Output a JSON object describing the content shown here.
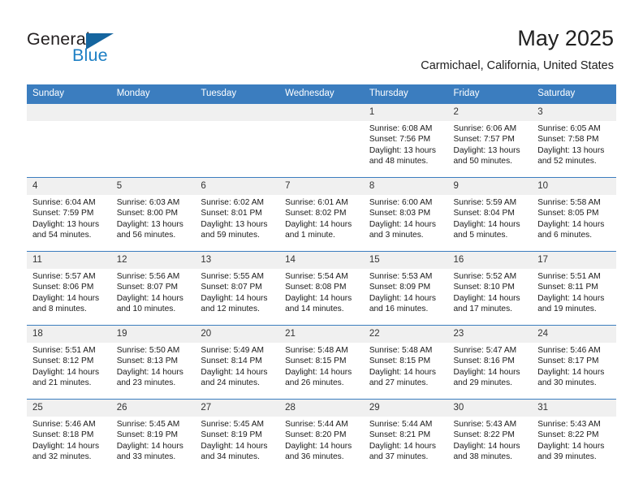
{
  "brand": {
    "name_part1": "General",
    "name_part2": "Blue",
    "flag_icon": "triangle-flag-icon",
    "accent_color": "#1d7fc4",
    "header_color": "#3b7dbf"
  },
  "header": {
    "month_title": "May 2025",
    "location": "Carmichael, California, United States"
  },
  "weekday_headers": [
    "Sunday",
    "Monday",
    "Tuesday",
    "Wednesday",
    "Thursday",
    "Friday",
    "Saturday"
  ],
  "weeks": [
    [
      {
        "day": "",
        "sunrise": "",
        "sunset": "",
        "daylight": "",
        "blank": true
      },
      {
        "day": "",
        "sunrise": "",
        "sunset": "",
        "daylight": "",
        "blank": true
      },
      {
        "day": "",
        "sunrise": "",
        "sunset": "",
        "daylight": "",
        "blank": true
      },
      {
        "day": "",
        "sunrise": "",
        "sunset": "",
        "daylight": "",
        "blank": true
      },
      {
        "day": "1",
        "sunrise": "Sunrise: 6:08 AM",
        "sunset": "Sunset: 7:56 PM",
        "daylight": "Daylight: 13 hours and 48 minutes."
      },
      {
        "day": "2",
        "sunrise": "Sunrise: 6:06 AM",
        "sunset": "Sunset: 7:57 PM",
        "daylight": "Daylight: 13 hours and 50 minutes."
      },
      {
        "day": "3",
        "sunrise": "Sunrise: 6:05 AM",
        "sunset": "Sunset: 7:58 PM",
        "daylight": "Daylight: 13 hours and 52 minutes."
      }
    ],
    [
      {
        "day": "4",
        "sunrise": "Sunrise: 6:04 AM",
        "sunset": "Sunset: 7:59 PM",
        "daylight": "Daylight: 13 hours and 54 minutes."
      },
      {
        "day": "5",
        "sunrise": "Sunrise: 6:03 AM",
        "sunset": "Sunset: 8:00 PM",
        "daylight": "Daylight: 13 hours and 56 minutes."
      },
      {
        "day": "6",
        "sunrise": "Sunrise: 6:02 AM",
        "sunset": "Sunset: 8:01 PM",
        "daylight": "Daylight: 13 hours and 59 minutes."
      },
      {
        "day": "7",
        "sunrise": "Sunrise: 6:01 AM",
        "sunset": "Sunset: 8:02 PM",
        "daylight": "Daylight: 14 hours and 1 minute."
      },
      {
        "day": "8",
        "sunrise": "Sunrise: 6:00 AM",
        "sunset": "Sunset: 8:03 PM",
        "daylight": "Daylight: 14 hours and 3 minutes."
      },
      {
        "day": "9",
        "sunrise": "Sunrise: 5:59 AM",
        "sunset": "Sunset: 8:04 PM",
        "daylight": "Daylight: 14 hours and 5 minutes."
      },
      {
        "day": "10",
        "sunrise": "Sunrise: 5:58 AM",
        "sunset": "Sunset: 8:05 PM",
        "daylight": "Daylight: 14 hours and 6 minutes."
      }
    ],
    [
      {
        "day": "11",
        "sunrise": "Sunrise: 5:57 AM",
        "sunset": "Sunset: 8:06 PM",
        "daylight": "Daylight: 14 hours and 8 minutes."
      },
      {
        "day": "12",
        "sunrise": "Sunrise: 5:56 AM",
        "sunset": "Sunset: 8:07 PM",
        "daylight": "Daylight: 14 hours and 10 minutes."
      },
      {
        "day": "13",
        "sunrise": "Sunrise: 5:55 AM",
        "sunset": "Sunset: 8:07 PM",
        "daylight": "Daylight: 14 hours and 12 minutes."
      },
      {
        "day": "14",
        "sunrise": "Sunrise: 5:54 AM",
        "sunset": "Sunset: 8:08 PM",
        "daylight": "Daylight: 14 hours and 14 minutes."
      },
      {
        "day": "15",
        "sunrise": "Sunrise: 5:53 AM",
        "sunset": "Sunset: 8:09 PM",
        "daylight": "Daylight: 14 hours and 16 minutes."
      },
      {
        "day": "16",
        "sunrise": "Sunrise: 5:52 AM",
        "sunset": "Sunset: 8:10 PM",
        "daylight": "Daylight: 14 hours and 17 minutes."
      },
      {
        "day": "17",
        "sunrise": "Sunrise: 5:51 AM",
        "sunset": "Sunset: 8:11 PM",
        "daylight": "Daylight: 14 hours and 19 minutes."
      }
    ],
    [
      {
        "day": "18",
        "sunrise": "Sunrise: 5:51 AM",
        "sunset": "Sunset: 8:12 PM",
        "daylight": "Daylight: 14 hours and 21 minutes."
      },
      {
        "day": "19",
        "sunrise": "Sunrise: 5:50 AM",
        "sunset": "Sunset: 8:13 PM",
        "daylight": "Daylight: 14 hours and 23 minutes."
      },
      {
        "day": "20",
        "sunrise": "Sunrise: 5:49 AM",
        "sunset": "Sunset: 8:14 PM",
        "daylight": "Daylight: 14 hours and 24 minutes."
      },
      {
        "day": "21",
        "sunrise": "Sunrise: 5:48 AM",
        "sunset": "Sunset: 8:15 PM",
        "daylight": "Daylight: 14 hours and 26 minutes."
      },
      {
        "day": "22",
        "sunrise": "Sunrise: 5:48 AM",
        "sunset": "Sunset: 8:15 PM",
        "daylight": "Daylight: 14 hours and 27 minutes."
      },
      {
        "day": "23",
        "sunrise": "Sunrise: 5:47 AM",
        "sunset": "Sunset: 8:16 PM",
        "daylight": "Daylight: 14 hours and 29 minutes."
      },
      {
        "day": "24",
        "sunrise": "Sunrise: 5:46 AM",
        "sunset": "Sunset: 8:17 PM",
        "daylight": "Daylight: 14 hours and 30 minutes."
      }
    ],
    [
      {
        "day": "25",
        "sunrise": "Sunrise: 5:46 AM",
        "sunset": "Sunset: 8:18 PM",
        "daylight": "Daylight: 14 hours and 32 minutes."
      },
      {
        "day": "26",
        "sunrise": "Sunrise: 5:45 AM",
        "sunset": "Sunset: 8:19 PM",
        "daylight": "Daylight: 14 hours and 33 minutes."
      },
      {
        "day": "27",
        "sunrise": "Sunrise: 5:45 AM",
        "sunset": "Sunset: 8:19 PM",
        "daylight": "Daylight: 14 hours and 34 minutes."
      },
      {
        "day": "28",
        "sunrise": "Sunrise: 5:44 AM",
        "sunset": "Sunset: 8:20 PM",
        "daylight": "Daylight: 14 hours and 36 minutes."
      },
      {
        "day": "29",
        "sunrise": "Sunrise: 5:44 AM",
        "sunset": "Sunset: 8:21 PM",
        "daylight": "Daylight: 14 hours and 37 minutes."
      },
      {
        "day": "30",
        "sunrise": "Sunrise: 5:43 AM",
        "sunset": "Sunset: 8:22 PM",
        "daylight": "Daylight: 14 hours and 38 minutes."
      },
      {
        "day": "31",
        "sunrise": "Sunrise: 5:43 AM",
        "sunset": "Sunset: 8:22 PM",
        "daylight": "Daylight: 14 hours and 39 minutes."
      }
    ]
  ]
}
